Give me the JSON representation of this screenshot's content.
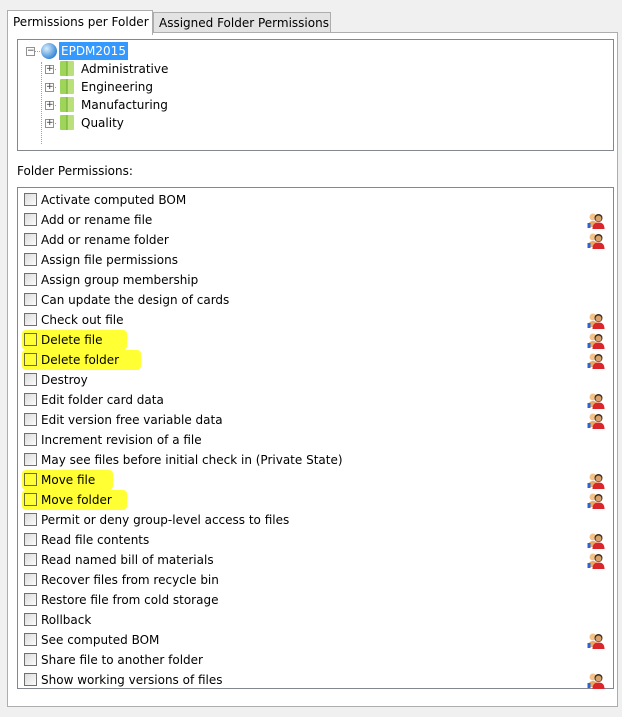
{
  "tabs": [
    {
      "label": "Permissions per Folder",
      "active": true
    },
    {
      "label": "Assigned Folder Permissions",
      "active": false
    }
  ],
  "tree": {
    "root": {
      "label": "EPDM2015",
      "icon": "vault-icon",
      "expanded": true,
      "selected": true
    },
    "children": [
      {
        "label": "Administrative",
        "icon": "folder-icon"
      },
      {
        "label": "Engineering",
        "icon": "folder-icon"
      },
      {
        "label": "Manufacturing",
        "icon": "folder-icon"
      },
      {
        "label": "Quality",
        "icon": "folder-icon"
      }
    ]
  },
  "folder_permissions": {
    "label": "Folder Permissions:",
    "highlight_color": "#ffff33",
    "items": [
      {
        "label": "Activate computed BOM",
        "checked": false,
        "group_icon": false,
        "highlighted": false
      },
      {
        "label": "Add or rename file",
        "checked": false,
        "group_icon": true,
        "highlighted": false
      },
      {
        "label": "Add or rename folder",
        "checked": false,
        "group_icon": true,
        "highlighted": false
      },
      {
        "label": "Assign file permissions",
        "checked": false,
        "group_icon": false,
        "highlighted": false
      },
      {
        "label": "Assign group membership",
        "checked": false,
        "group_icon": false,
        "highlighted": false
      },
      {
        "label": "Can update the design of cards",
        "checked": false,
        "group_icon": false,
        "highlighted": false
      },
      {
        "label": "Check out file",
        "checked": false,
        "group_icon": true,
        "highlighted": false
      },
      {
        "label": "Delete file",
        "checked": false,
        "group_icon": true,
        "highlighted": true
      },
      {
        "label": "Delete folder",
        "checked": false,
        "group_icon": true,
        "highlighted": true
      },
      {
        "label": "Destroy",
        "checked": false,
        "group_icon": false,
        "highlighted": false
      },
      {
        "label": "Edit folder card data",
        "checked": false,
        "group_icon": true,
        "highlighted": false
      },
      {
        "label": "Edit version free variable data",
        "checked": false,
        "group_icon": true,
        "highlighted": false
      },
      {
        "label": "Increment revision of a file",
        "checked": false,
        "group_icon": false,
        "highlighted": false
      },
      {
        "label": "May see files before initial check in (Private State)",
        "checked": false,
        "group_icon": false,
        "highlighted": false
      },
      {
        "label": "Move file",
        "checked": false,
        "group_icon": true,
        "highlighted": true
      },
      {
        "label": "Move folder",
        "checked": false,
        "group_icon": true,
        "highlighted": true
      },
      {
        "label": "Permit or deny group-level access to files",
        "checked": false,
        "group_icon": false,
        "highlighted": false
      },
      {
        "label": "Read file contents",
        "checked": false,
        "group_icon": true,
        "highlighted": false
      },
      {
        "label": "Read named bill of materials",
        "checked": false,
        "group_icon": true,
        "highlighted": false
      },
      {
        "label": "Recover files from recycle bin",
        "checked": false,
        "group_icon": false,
        "highlighted": false
      },
      {
        "label": "Restore file from cold storage",
        "checked": false,
        "group_icon": false,
        "highlighted": false
      },
      {
        "label": "Rollback",
        "checked": false,
        "group_icon": false,
        "highlighted": false
      },
      {
        "label": "See computed BOM",
        "checked": false,
        "group_icon": true,
        "highlighted": false
      },
      {
        "label": "Share file to another folder",
        "checked": false,
        "group_icon": false,
        "highlighted": false
      },
      {
        "label": "Show working versions of files",
        "checked": false,
        "group_icon": true,
        "highlighted": false
      }
    ]
  }
}
